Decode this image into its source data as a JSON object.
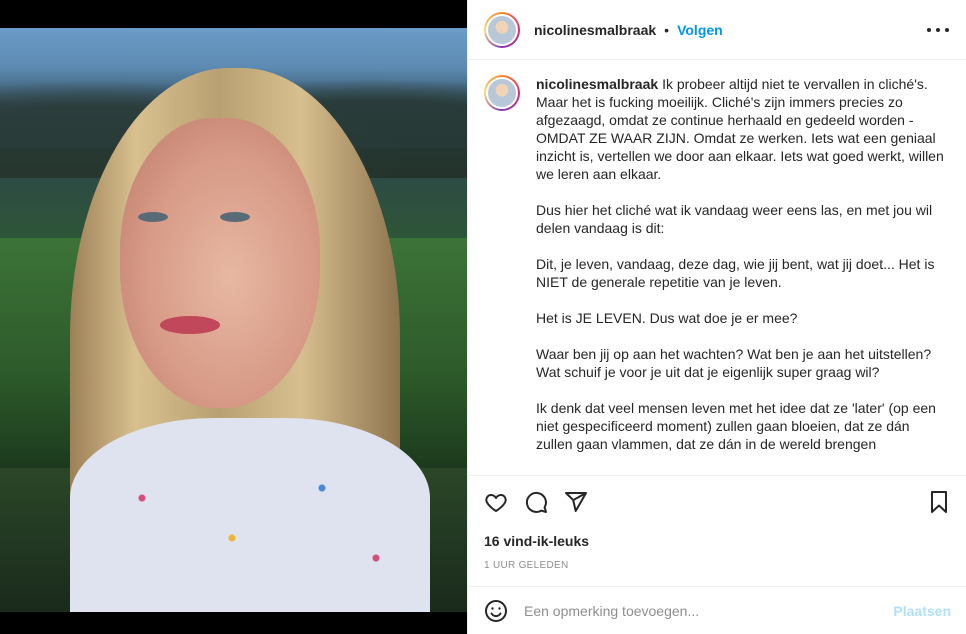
{
  "post": {
    "username": "nicolinesmalbraak",
    "dot": "•",
    "follow_label": "Volgen",
    "caption_username": "nicolinesmalbraak",
    "caption_paragraphs": [
      "Ik probeer altijd niet te vervallen in cliché's. Maar het is fucking moeilijk. Cliché's zijn immers precies zo afgezaagd, omdat ze continue herhaald en gedeeld worden - OMDAT ZE WAAR ZIJN. Omdat ze werken. Iets wat een geniaal inzicht is, vertellen we door aan elkaar. Iets wat goed werkt, willen we leren aan elkaar.",
      "Dus hier het cliché wat ik vandaag weer eens las, en met jou wil delen vandaag is dit:",
      "Dit, je leven, vandaag, deze dag, wie jij bent, wat jij doet... Het is NIET de generale repetitie van je leven.",
      "Het is JE LEVEN. Dus wat doe je er mee?",
      "Waar ben jij op aan het wachten? Wat ben je aan het uitstellen? Wat schuif je voor je uit dat je eigenlijk super graag wil?",
      "Ik denk dat veel mensen leven met het idee dat ze 'later' (op een niet gespecificeerd moment) zullen gaan bloeien, dat ze dán zullen gaan vlammen, dat ze dán in de wereld brengen"
    ],
    "likes": "16 vind-ik-leuks",
    "time": "1 UUR GELEDEN"
  },
  "comment": {
    "placeholder": "Een opmerking toevoegen...",
    "post_label": "Plaatsen"
  },
  "icons": {
    "more": "more-options-icon",
    "like": "heart-icon",
    "comment": "comment-icon",
    "share": "paper-plane-icon",
    "save": "bookmark-icon",
    "emoji": "emoji-icon"
  },
  "colors": {
    "accent": "#0095f6",
    "post_disabled": "#b2dffc",
    "muted": "#8e8e8e",
    "text": "#262626"
  }
}
